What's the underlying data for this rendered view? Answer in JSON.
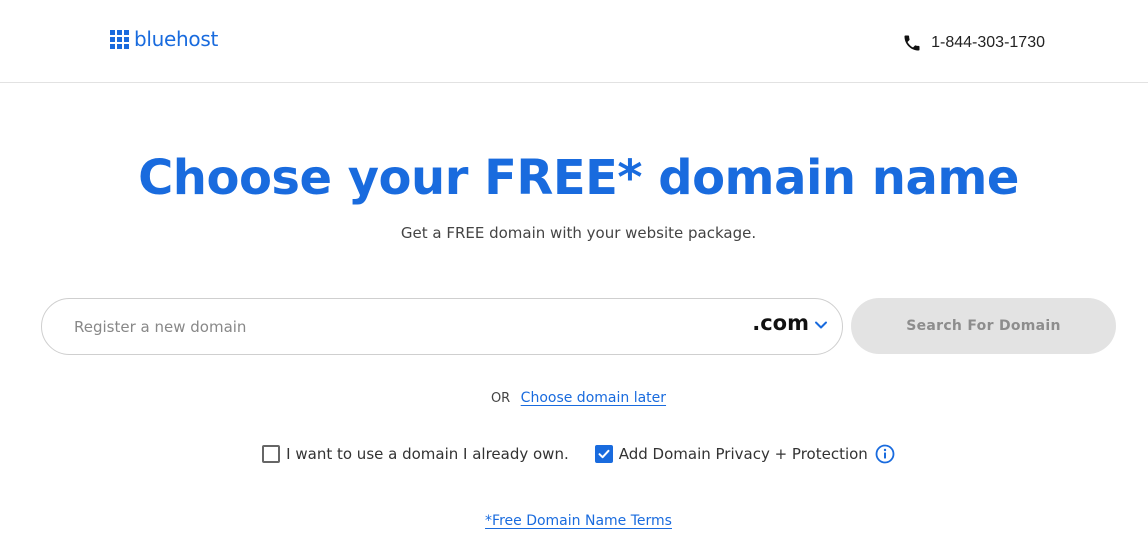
{
  "header": {
    "logo_text": "bluehost",
    "phone": "1-844-303-1730"
  },
  "main": {
    "title": "Choose your FREE* domain name",
    "subtitle": "Get a FREE domain with your website package."
  },
  "search": {
    "placeholder": "Register a new domain",
    "value": "",
    "tld": ".com",
    "button_label": "Search For Domain"
  },
  "alternatives": {
    "or_label": "OR",
    "choose_later_link": "Choose domain later"
  },
  "options": {
    "own_domain_label": "I want to use a domain I already own.",
    "own_domain_checked": false,
    "privacy_label": "Add Domain Privacy + Protection",
    "privacy_checked": true
  },
  "footer": {
    "terms_link": "*Free Domain Name Terms"
  },
  "colors": {
    "brand_blue": "#196bde",
    "button_disabled_bg": "#e3e3e3",
    "button_disabled_text": "#8d8d8d"
  },
  "icons": {
    "logo": "grid-logo-icon",
    "phone": "phone-icon",
    "tld_dropdown": "chevron-down-icon",
    "checkbox_checked": "checkmark-icon",
    "info": "info-icon"
  }
}
